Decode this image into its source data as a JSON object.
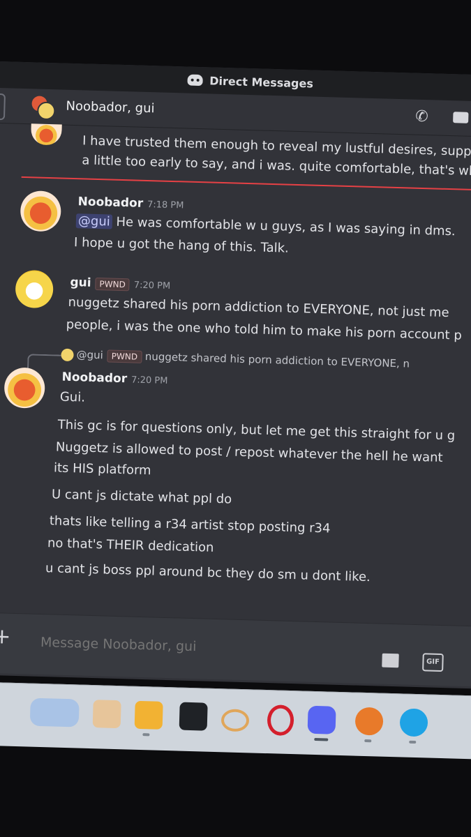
{
  "window": {
    "title": "Direct Messages"
  },
  "channel": {
    "name": "Noobador, gui"
  },
  "previous_message": {
    "lines": [
      "I have trusted them enough to reveal my lustful desires, suppo",
      "a little too early to say, and i was. quite comfortable, that's wh"
    ]
  },
  "messages": [
    {
      "author": "Noobador",
      "time": "7:18 PM",
      "mention": "@gui",
      "lines": [
        "He was comfortable w u guys, as I was saying in dms.",
        "I hope u got the hang of this. Talk."
      ]
    },
    {
      "author": "gui",
      "badge": "PWND",
      "time": "7:20 PM",
      "lines": [
        "nuggetz shared his porn addiction to EVERYONE, not just me",
        "people, i was the one who told him to make his porn account p"
      ]
    },
    {
      "reply": {
        "mention": "@gui",
        "badge": "PWND",
        "preview": "nuggetz shared his porn addiction to EVERYONE, n"
      },
      "author": "Noobador",
      "time": "7:20 PM",
      "lines": [
        "Gui.",
        "This gc is for questions only, but let me get this straight for u g",
        "Nuggetz is allowed to post / repost whatever the hell he want",
        "its HIS platform",
        "U cant js dictate what ppl do",
        "thats like telling a r34 artist stop posting r34",
        "no that's THEIR dedication",
        "u cant js boss ppl around bc they do sm u dont like."
      ]
    }
  ],
  "composer": {
    "placeholder": "Message Noobador, gui",
    "gif_label": "GIF"
  },
  "icons": [
    "discord-logo-icon",
    "call-icon",
    "video-icon",
    "plus-icon",
    "gift-icon",
    "gif-icon"
  ],
  "colors": {
    "background": "#323339",
    "titlebar": "#1e1f22",
    "new_divider": "#e64145",
    "mention": "#3d4270"
  }
}
